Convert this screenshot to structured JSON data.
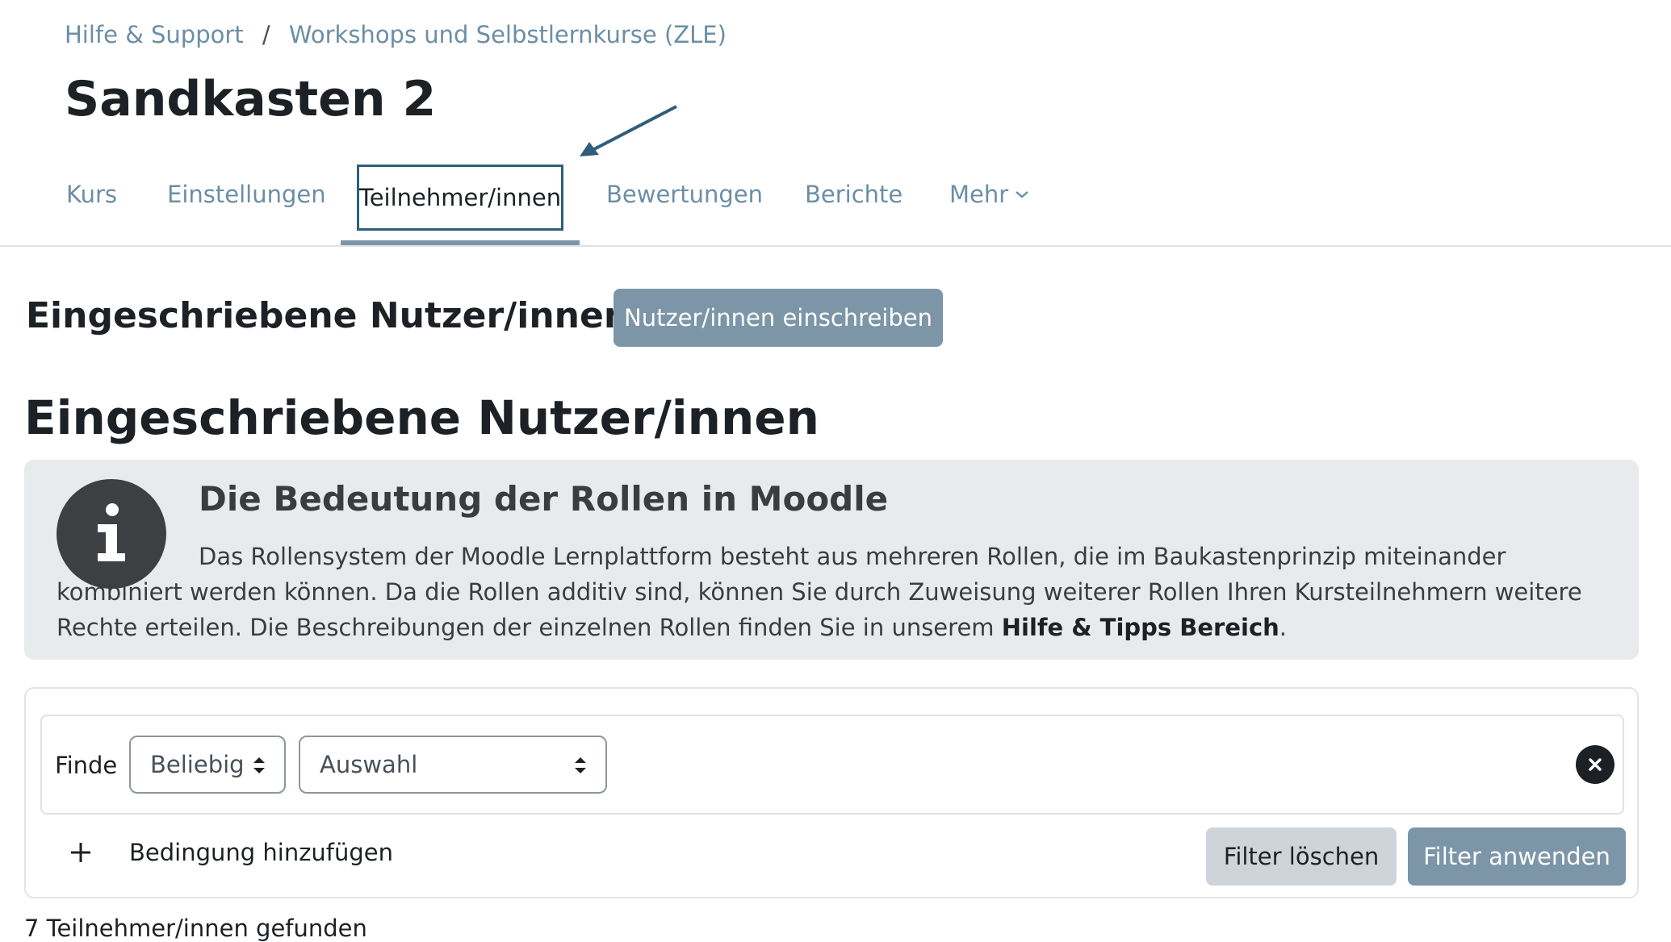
{
  "breadcrumb": {
    "items": [
      "Hilfe & Support",
      "Workshops und Selbstlernkurse (ZLE)"
    ],
    "separator": "/"
  },
  "page_title": "Sandkasten 2",
  "tabs": [
    {
      "label": "Kurs"
    },
    {
      "label": "Einstellungen"
    },
    {
      "label": "Teilnehmer/innen",
      "active": true
    },
    {
      "label": "Bewertungen"
    },
    {
      "label": "Berichte"
    },
    {
      "label": "Mehr"
    }
  ],
  "section": {
    "dropdown_label": "Eingeschriebene Nutzer/innen",
    "enrol_button": "Nutzer/innen einschreiben",
    "heading": "Eingeschriebene Nutzer/innen"
  },
  "info": {
    "title": "Die Bedeutung der Rollen in Moodle",
    "text": "Das Rollensystem der Moodle Lernplattform besteht aus mehreren Rollen, die im Baukastenprinzip miteinander kombiniert werden können. Da die Rollen additiv sind, können Sie durch Zuweisung weiterer Rollen Ihren Kursteilnehmern weitere Rechte erteilen. Die Beschreibungen der einzelnen Rollen finden Sie in unserem ",
    "link": "Hilfe & Tipps Bereich",
    "end": "."
  },
  "filter": {
    "find_label": "Finde",
    "match_select": "Beliebig",
    "type_select": "Auswahl",
    "add_condition": "Bedingung hinzufügen",
    "clear_button": "Filter löschen",
    "apply_button": "Filter anwenden"
  },
  "participants_found": "7 Teilnehmer/innen gefunden",
  "colors": {
    "accent": "#7c96a8",
    "link": "#6b8ea6",
    "active_border": "#2d5f7b",
    "info_bg": "#e9eaec"
  }
}
